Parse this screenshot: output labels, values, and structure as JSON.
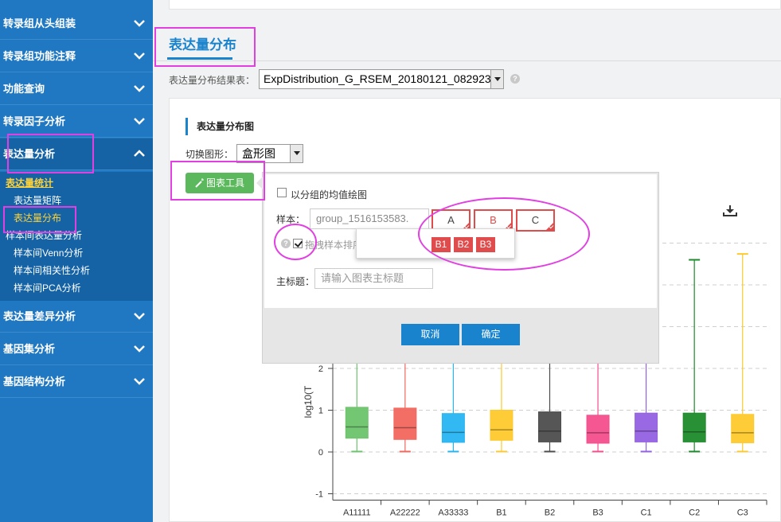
{
  "sidebar": {
    "menus": [
      {
        "label": "转录组从头组装",
        "state": "collapsed"
      },
      {
        "label": "转录组功能注释",
        "state": "collapsed"
      },
      {
        "label": "功能查询",
        "state": "collapsed"
      },
      {
        "label": "转录因子分析",
        "state": "collapsed"
      },
      {
        "label": "表达量分析",
        "state": "expanded"
      },
      {
        "label": "表达量差异分析",
        "state": "collapsed"
      },
      {
        "label": "基因集分析",
        "state": "collapsed"
      },
      {
        "label": "基因结构分析",
        "state": "collapsed"
      }
    ],
    "submenu": [
      "表达量统计",
      "表达量矩阵",
      "表达量分布",
      "样本间表达量分析",
      "样本间Venn分析",
      "样本间相关性分析",
      "样本间PCA分析"
    ]
  },
  "main": {
    "page_title": "表达量分布",
    "result_label": "表达量分布结果表：",
    "result_value": "ExpDistribution_G_RSEM_20180121_082923",
    "card_title": "表达量分布图",
    "switch_label": "切换图形：",
    "switch_value": "盒形图",
    "tool_button": "图表工具"
  },
  "popup": {
    "group_mean_label": "以分组的均值绘图",
    "group_mean_checked": false,
    "sample_label": "样本：",
    "sample_value": "group_1516153583.",
    "groups": [
      "A",
      "B",
      "C"
    ],
    "active_group": "B",
    "dropdown_items": [
      "B1",
      "B2",
      "B3"
    ],
    "drag_label": "拖拽样本排序",
    "drag_checked": true,
    "main_title_label": "主标题：",
    "main_title_placeholder": "请输入图表主标题",
    "cancel": "取消",
    "confirm": "确定"
  },
  "colors": {
    "sidebar": "#1f78c1",
    "accent": "#1a83cd",
    "tool_button": "#5cb85c",
    "group_red": "#e04b4b",
    "highlight": "#e23fe2"
  },
  "chart_data": {
    "type": "box",
    "ylabel": "log10(T",
    "y_ticks": [
      "2",
      "1",
      "0",
      "-1"
    ],
    "categories": [
      "A11111",
      "A22222",
      "A33333",
      "B1",
      "B2",
      "B3",
      "C1",
      "C2",
      "C3"
    ],
    "series": [
      {
        "category": "A11111",
        "color": "#6cc46c",
        "q1": 0.33,
        "median": 0.6,
        "q3": 1.07,
        "min": 0.01,
        "max": null
      },
      {
        "category": "A22222",
        "color": "#f2675e",
        "q1": 0.3,
        "median": 0.58,
        "q3": 1.05,
        "min": 0.01,
        "max": null
      },
      {
        "category": "A33333",
        "color": "#27b5f2",
        "q1": 0.23,
        "median": 0.47,
        "q3": 0.92,
        "min": 0.01,
        "max": null
      },
      {
        "category": "B1",
        "color": "#fdc92c",
        "q1": 0.28,
        "median": 0.53,
        "q3": 1.0,
        "min": 0.01,
        "max": null
      },
      {
        "category": "B2",
        "color": "#4d4d4d",
        "q1": 0.24,
        "median": 0.5,
        "q3": 0.96,
        "min": 0.01,
        "max": null
      },
      {
        "category": "B3",
        "color": "#f44e8c",
        "q1": 0.21,
        "median": 0.46,
        "q3": 0.88,
        "min": 0.01,
        "max": null
      },
      {
        "category": "C1",
        "color": "#9361e3",
        "q1": 0.24,
        "median": 0.5,
        "q3": 0.93,
        "min": 0.01,
        "max": null
      },
      {
        "category": "C2",
        "color": "#1d8b2a",
        "q1": 0.24,
        "median": 0.48,
        "q3": 0.93,
        "min": 0.01,
        "max": 4.6
      },
      {
        "category": "C3",
        "color": "#fdc92c",
        "q1": 0.22,
        "median": 0.46,
        "q3": 0.9,
        "min": 0.01,
        "max": 4.74
      }
    ]
  }
}
